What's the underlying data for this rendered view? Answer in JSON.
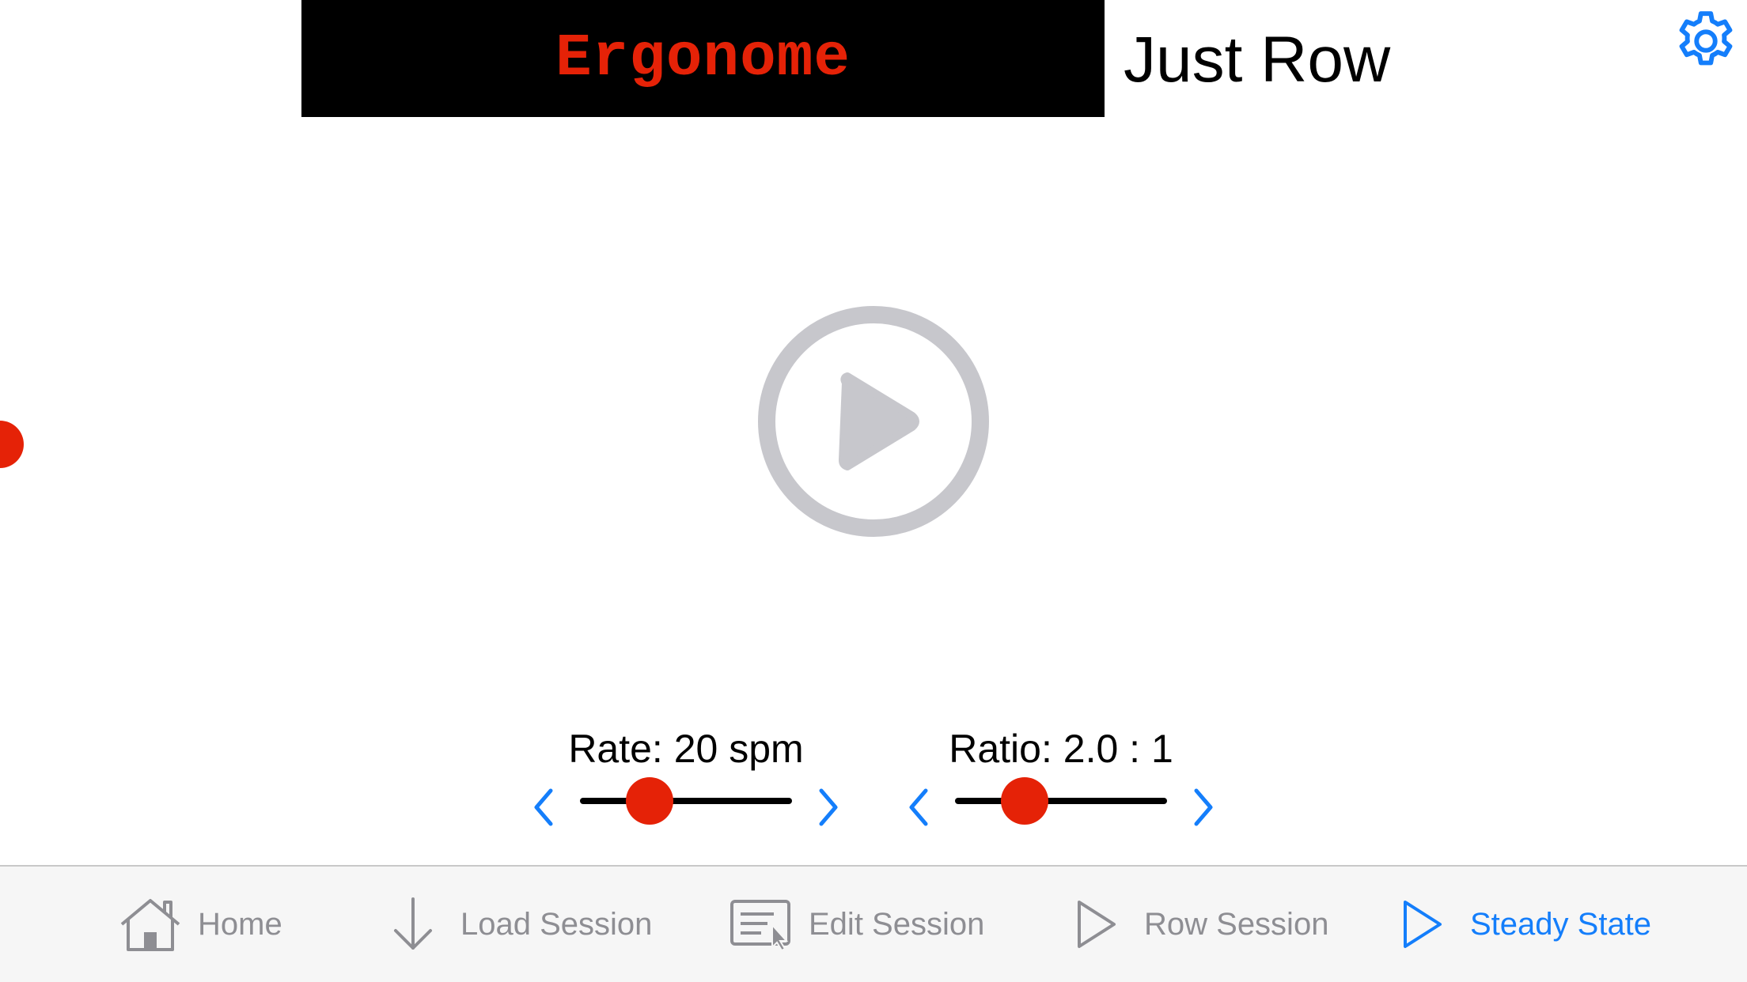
{
  "header": {
    "logo_text": "Ergonome",
    "title": "Just Row",
    "settings_icon": "gear-icon"
  },
  "main": {
    "play_icon": "play-circle-icon"
  },
  "controls": {
    "rate": {
      "label": "Rate: 20 spm",
      "slider_fraction": 0.33
    },
    "ratio": {
      "label": "Ratio: 2.0 : 1",
      "slider_fraction": 0.33
    }
  },
  "tabs": [
    {
      "label": "Home",
      "icon": "home-icon",
      "active": false
    },
    {
      "label": "Load Session",
      "icon": "download-arrow-icon",
      "active": false
    },
    {
      "label": "Edit Session",
      "icon": "edit-document-icon",
      "active": false
    },
    {
      "label": "Row Session",
      "icon": "play-outline-icon",
      "active": false
    },
    {
      "label": "Steady State",
      "icon": "play-outline-icon",
      "active": true
    }
  ],
  "colors": {
    "accent_red": "#e52207",
    "ios_blue": "#147efb",
    "inactive_gray": "#8e8e93",
    "play_gray": "#c7c7cc"
  }
}
